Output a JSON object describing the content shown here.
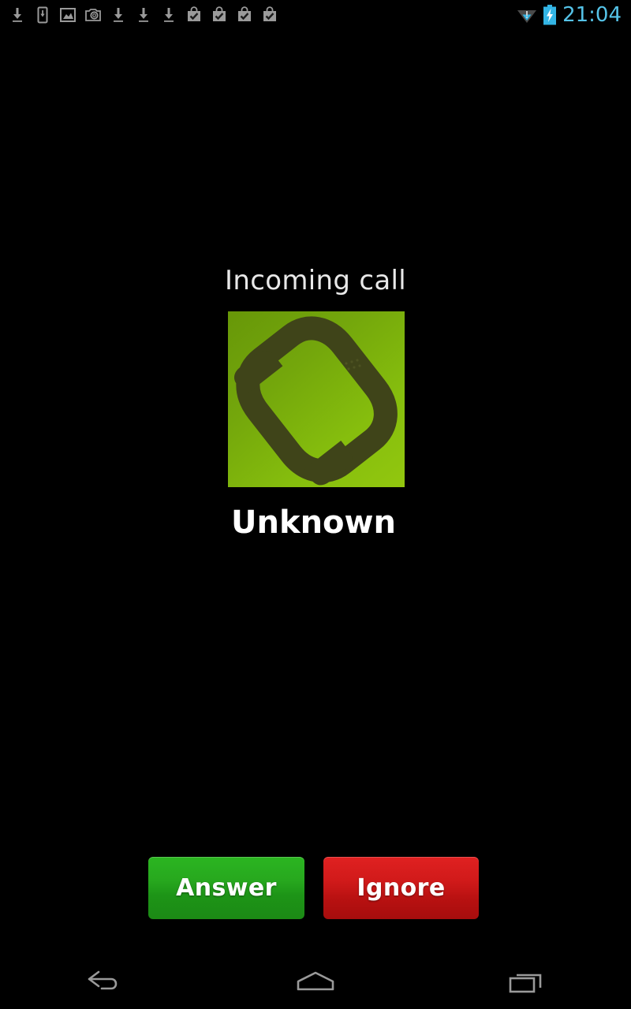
{
  "status_bar": {
    "left_icons": [
      {
        "name": "download-icon",
        "label": "download"
      },
      {
        "name": "download-to-device-icon",
        "label": "download to device"
      },
      {
        "name": "image-icon",
        "label": "image saved"
      },
      {
        "name": "camera-icon",
        "label": "screenshot captured"
      },
      {
        "name": "download-icon",
        "label": "download"
      },
      {
        "name": "download-icon",
        "label": "download"
      },
      {
        "name": "download-icon",
        "label": "download"
      },
      {
        "name": "bag-check-icon",
        "label": "app installed"
      },
      {
        "name": "bag-check-icon",
        "label": "app installed"
      },
      {
        "name": "bag-check-icon",
        "label": "app installed"
      },
      {
        "name": "bag-check-icon",
        "label": "app installed"
      }
    ],
    "wifi_icon": "wifi-warning-icon",
    "battery_icon": "battery-charging-icon",
    "clock": "21:04",
    "clock_color": "#55c3e8",
    "battery_color": "#33b5e5"
  },
  "call": {
    "status_text": "Incoming call",
    "caller_name": "Unknown",
    "photo_icon": "phone-handset-icon",
    "photo_bg_from": "#679708",
    "photo_bg_to": "#92c70e",
    "handset_color": "#3f4419"
  },
  "actions": {
    "answer_label": "Answer",
    "answer_color": "#22a51c",
    "ignore_label": "Ignore",
    "ignore_color": "#c41515"
  },
  "nav_bar": {
    "back_icon": "back-arrow-icon",
    "home_icon": "home-icon",
    "recents_icon": "recent-apps-icon",
    "icon_color": "#9a9a9a"
  }
}
